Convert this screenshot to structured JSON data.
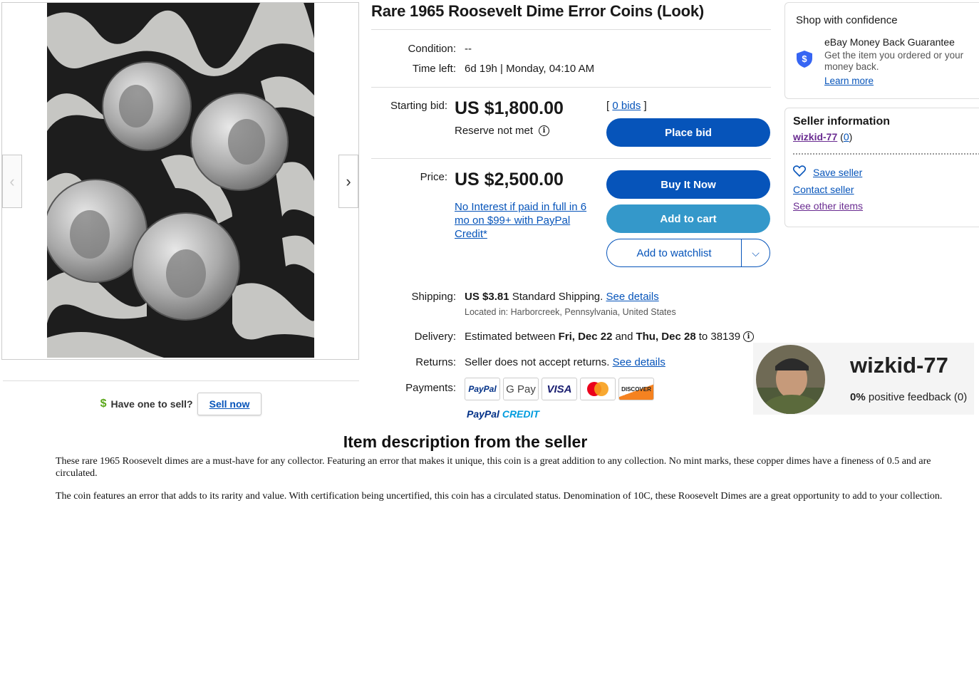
{
  "listing": {
    "title": "Rare 1965 Roosevelt Dime Error Coins (Look)",
    "condition_label": "Condition:",
    "condition_value": "--",
    "time_left_label": "Time left:",
    "time_left_value": "6d 19h | Monday, 04:10 AM"
  },
  "auction": {
    "starting_bid_label": "Starting bid:",
    "starting_bid": "US $1,800.00",
    "reserve": "Reserve not met",
    "bids_open": "[",
    "bids_link": "0 bids",
    "bids_close": "]",
    "place_bid": "Place bid"
  },
  "buy": {
    "price_label": "Price:",
    "price": "US $2,500.00",
    "credit_link": "No Interest if paid in full in 6 mo on $99+ with PayPal Credit*",
    "buy_now": "Buy It Now",
    "add_to_cart": "Add to cart",
    "add_to_watchlist": "Add to watchlist"
  },
  "shipping": {
    "label": "Shipping:",
    "cost": "US $3.81",
    "method": "Standard Shipping.",
    "details_link": "See details",
    "location": "Located in: Harborcreek, Pennsylvania, United States"
  },
  "delivery": {
    "label": "Delivery:",
    "prefix": "Estimated between",
    "start": "Fri, Dec 22",
    "and": "and",
    "end": "Thu, Dec 28",
    "to": "to 38139"
  },
  "returns": {
    "label": "Returns:",
    "text": "Seller does not accept returns.",
    "details_link": "See details"
  },
  "payments": {
    "label": "Payments:",
    "methods": [
      "PayPal",
      "G Pay",
      "VISA",
      "mastercard",
      "DISCOVER"
    ],
    "paypal_credit": [
      "PayPal",
      "CREDIT"
    ]
  },
  "sell": {
    "question": "Have one to sell?",
    "button": "Sell now"
  },
  "confidence": {
    "title": "Shop with confidence",
    "guarantee_title": "eBay Money Back Guarantee",
    "guarantee_text": "Get the item you ordered or your money back.",
    "learn_more": "Learn more"
  },
  "seller": {
    "title": "Seller information",
    "username": "wizkid-77",
    "feedback_count": "0",
    "save_seller": "Save seller",
    "contact": "Contact seller",
    "other_items": "See other items"
  },
  "profile_card": {
    "username": "wizkid-77",
    "feedback_pct": "0%",
    "feedback_text": "positive feedback (0)"
  },
  "description": {
    "heading": "Item description from the seller",
    "p1": "These rare 1965 Roosevelt dimes are a must-have for any collector. Featuring an error that makes it unique, this coin is a great addition to any collection. No mint marks, these copper dimes have a fineness of 0.5 and are circulated.",
    "p2": "The coin features an error that adds to its rarity and value. With certification being uncertified, this coin has a circulated status. Denomination of 10C, these Roosevelt Dimes are a great opportunity to add to your collection."
  },
  "colors": {
    "primary_blue": "#0654ba",
    "secondary_blue": "#3498ca",
    "visited_purple": "#6a2c91",
    "sell_dollar_green": "#5ba71b"
  },
  "icons": {
    "gallery_prev": "chevron-left-icon",
    "gallery_next": "chevron-right-icon",
    "reserve_info": "info-icon",
    "delivery_info": "info-icon",
    "watchlist_more": "chevron-down-icon",
    "guarantee": "shield-dollar-icon",
    "save_seller": "heart-icon",
    "sell": "dollar-icon"
  }
}
